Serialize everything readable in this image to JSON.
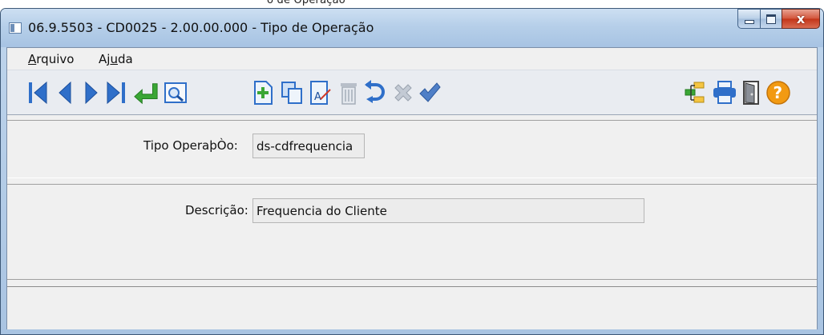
{
  "background": {
    "partial_text": "o de Operação"
  },
  "window": {
    "title": "06.9.5503 - CD0025 - 2.00.00.000 - Tipo de Operação",
    "close_glyph": "x"
  },
  "menu": {
    "items": [
      {
        "first": "A",
        "rest": "rquivo"
      },
      {
        "pre": "Aj",
        "under": "u",
        "post": "da"
      }
    ]
  },
  "toolbar": {
    "icons": [
      "first-record-icon",
      "previous-record-icon",
      "next-record-icon",
      "last-record-icon",
      "go-to-icon",
      "search-icon",
      "new-icon",
      "copy-icon",
      "edit-icon",
      "delete-icon",
      "undo-icon",
      "cancel-icon",
      "confirm-icon",
      "tree-icon",
      "print-icon",
      "exit-icon",
      "help-icon"
    ]
  },
  "form": {
    "tipo_label": "Tipo OperaþÒo:",
    "tipo_value": "ds-cdfrequencia",
    "descricao_label": "Descrição:",
    "descricao_value": "Frequencia do Cliente"
  },
  "colors": {
    "titlebar": "#b6cfe9",
    "nav_blue": "#2f6fc9",
    "confirm_green": "#3aa635",
    "help_orange": "#f29a12",
    "close_red": "#c23418"
  }
}
